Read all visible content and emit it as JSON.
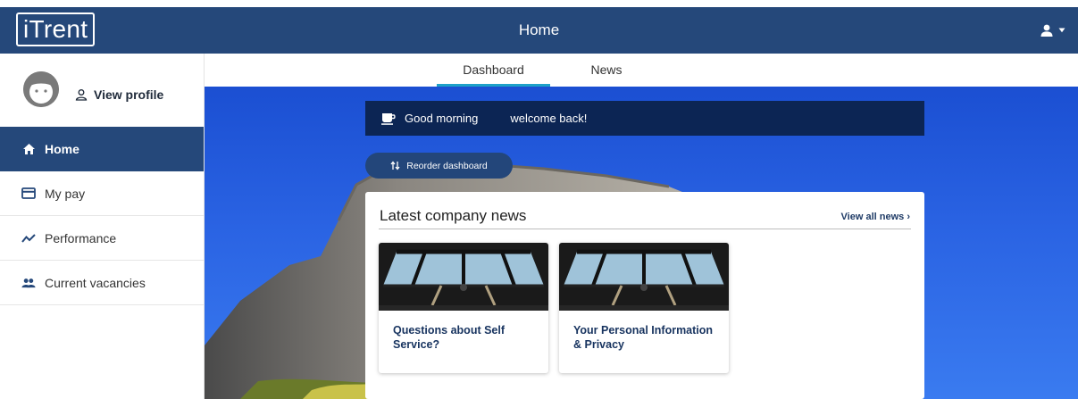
{
  "app": {
    "logo": "iTrent",
    "title": "Home"
  },
  "sidebar": {
    "view_profile": "View profile",
    "items": [
      {
        "label": "Home",
        "icon": "home-icon",
        "active": true
      },
      {
        "label": "My pay",
        "icon": "card-icon",
        "active": false
      },
      {
        "label": "Performance",
        "icon": "trend-icon",
        "active": false
      },
      {
        "label": "Current vacancies",
        "icon": "people-icon",
        "active": false
      }
    ]
  },
  "tabs": [
    {
      "label": "Dashboard",
      "active": true
    },
    {
      "label": "News",
      "active": false
    }
  ],
  "greeting": {
    "salutation": "Good morning",
    "message": "welcome back!"
  },
  "reorder_label": "Reorder dashboard",
  "news": {
    "title": "Latest company news",
    "view_all": "View all news",
    "articles": [
      {
        "title": "Questions about Self Service?"
      },
      {
        "title": "Your Personal Information & Privacy"
      }
    ]
  },
  "colors": {
    "header": "#25487a",
    "active_nav": "#25487a",
    "tab_underline": "#1ea1c8",
    "greeting_bg": "#0c2554"
  }
}
